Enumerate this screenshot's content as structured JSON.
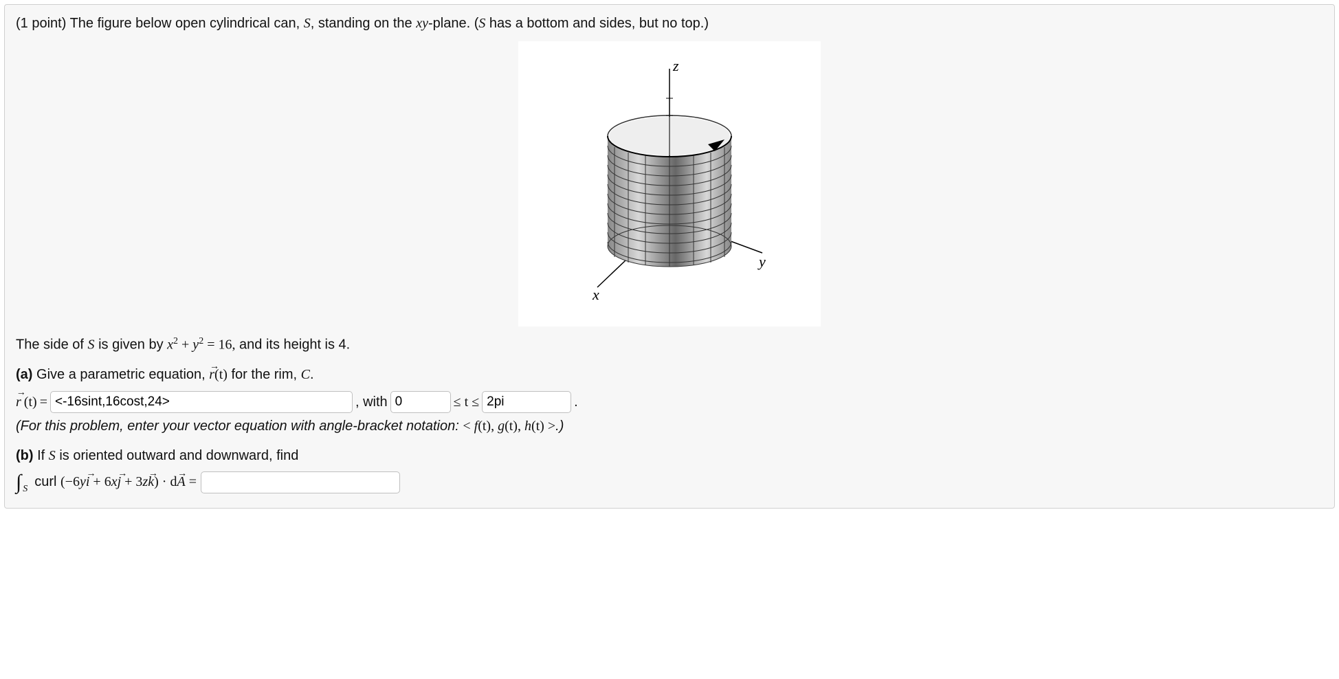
{
  "points": "(1 point)",
  "intro1": "The figure below open cylindrical can, ",
  "S": "S",
  "intro2": ", standing on the ",
  "xy": "xy",
  "intro3": "-plane. (",
  "intro4": " has a bottom and sides, but no top.)",
  "axes": {
    "x": "x",
    "y": "y",
    "z": "z"
  },
  "side_desc_1": "The side of ",
  "side_desc_2": " is given by ",
  "eq_lhs_x": "x",
  "eq_plus": " + ",
  "eq_lhs_y": "y",
  "eq_sq": "2",
  "eq_rhs": " = 16,",
  "side_desc_3": " and its height is 4.",
  "part_a_label": "(a)",
  "part_a_text": " Give a parametric equation, ",
  "r_of_t": "r",
  "t_paren": "(t)",
  "part_a_text2": " for the rim, ",
  "C": "C",
  "period": ".",
  "equals": " = ",
  "input_rt": "<-16sint,16cost,24>",
  "with": ", with ",
  "input_lo": "0",
  "leq_t_leq": " ≤ t ≤ ",
  "input_hi": "2pi",
  "note1": "(For this problem, enter your vector equation with angle-bracket notation: ",
  "note_open": "< ",
  "note_f": "f",
  "note_g": "g",
  "note_h": "h",
  "note_t": "(t)",
  "note_comma": ", ",
  "note_close": " >",
  "note_end": ".)",
  "part_b_label": "(b)",
  "part_b_text": " If ",
  "part_b_text2": " is oriented outward and downward, find",
  "curl_text": "curl ",
  "term1_coef": "(−6",
  "term1_var": "y",
  "i_hat": "i",
  "term2_coef": " + 6",
  "term2_var": "x",
  "j_hat": "j",
  "term3_coef": " + 3",
  "term3_var": "z",
  "k_hat": "k",
  "close_paren": ")",
  "dot": " · ",
  "dA": "dA",
  "input_ans": ""
}
